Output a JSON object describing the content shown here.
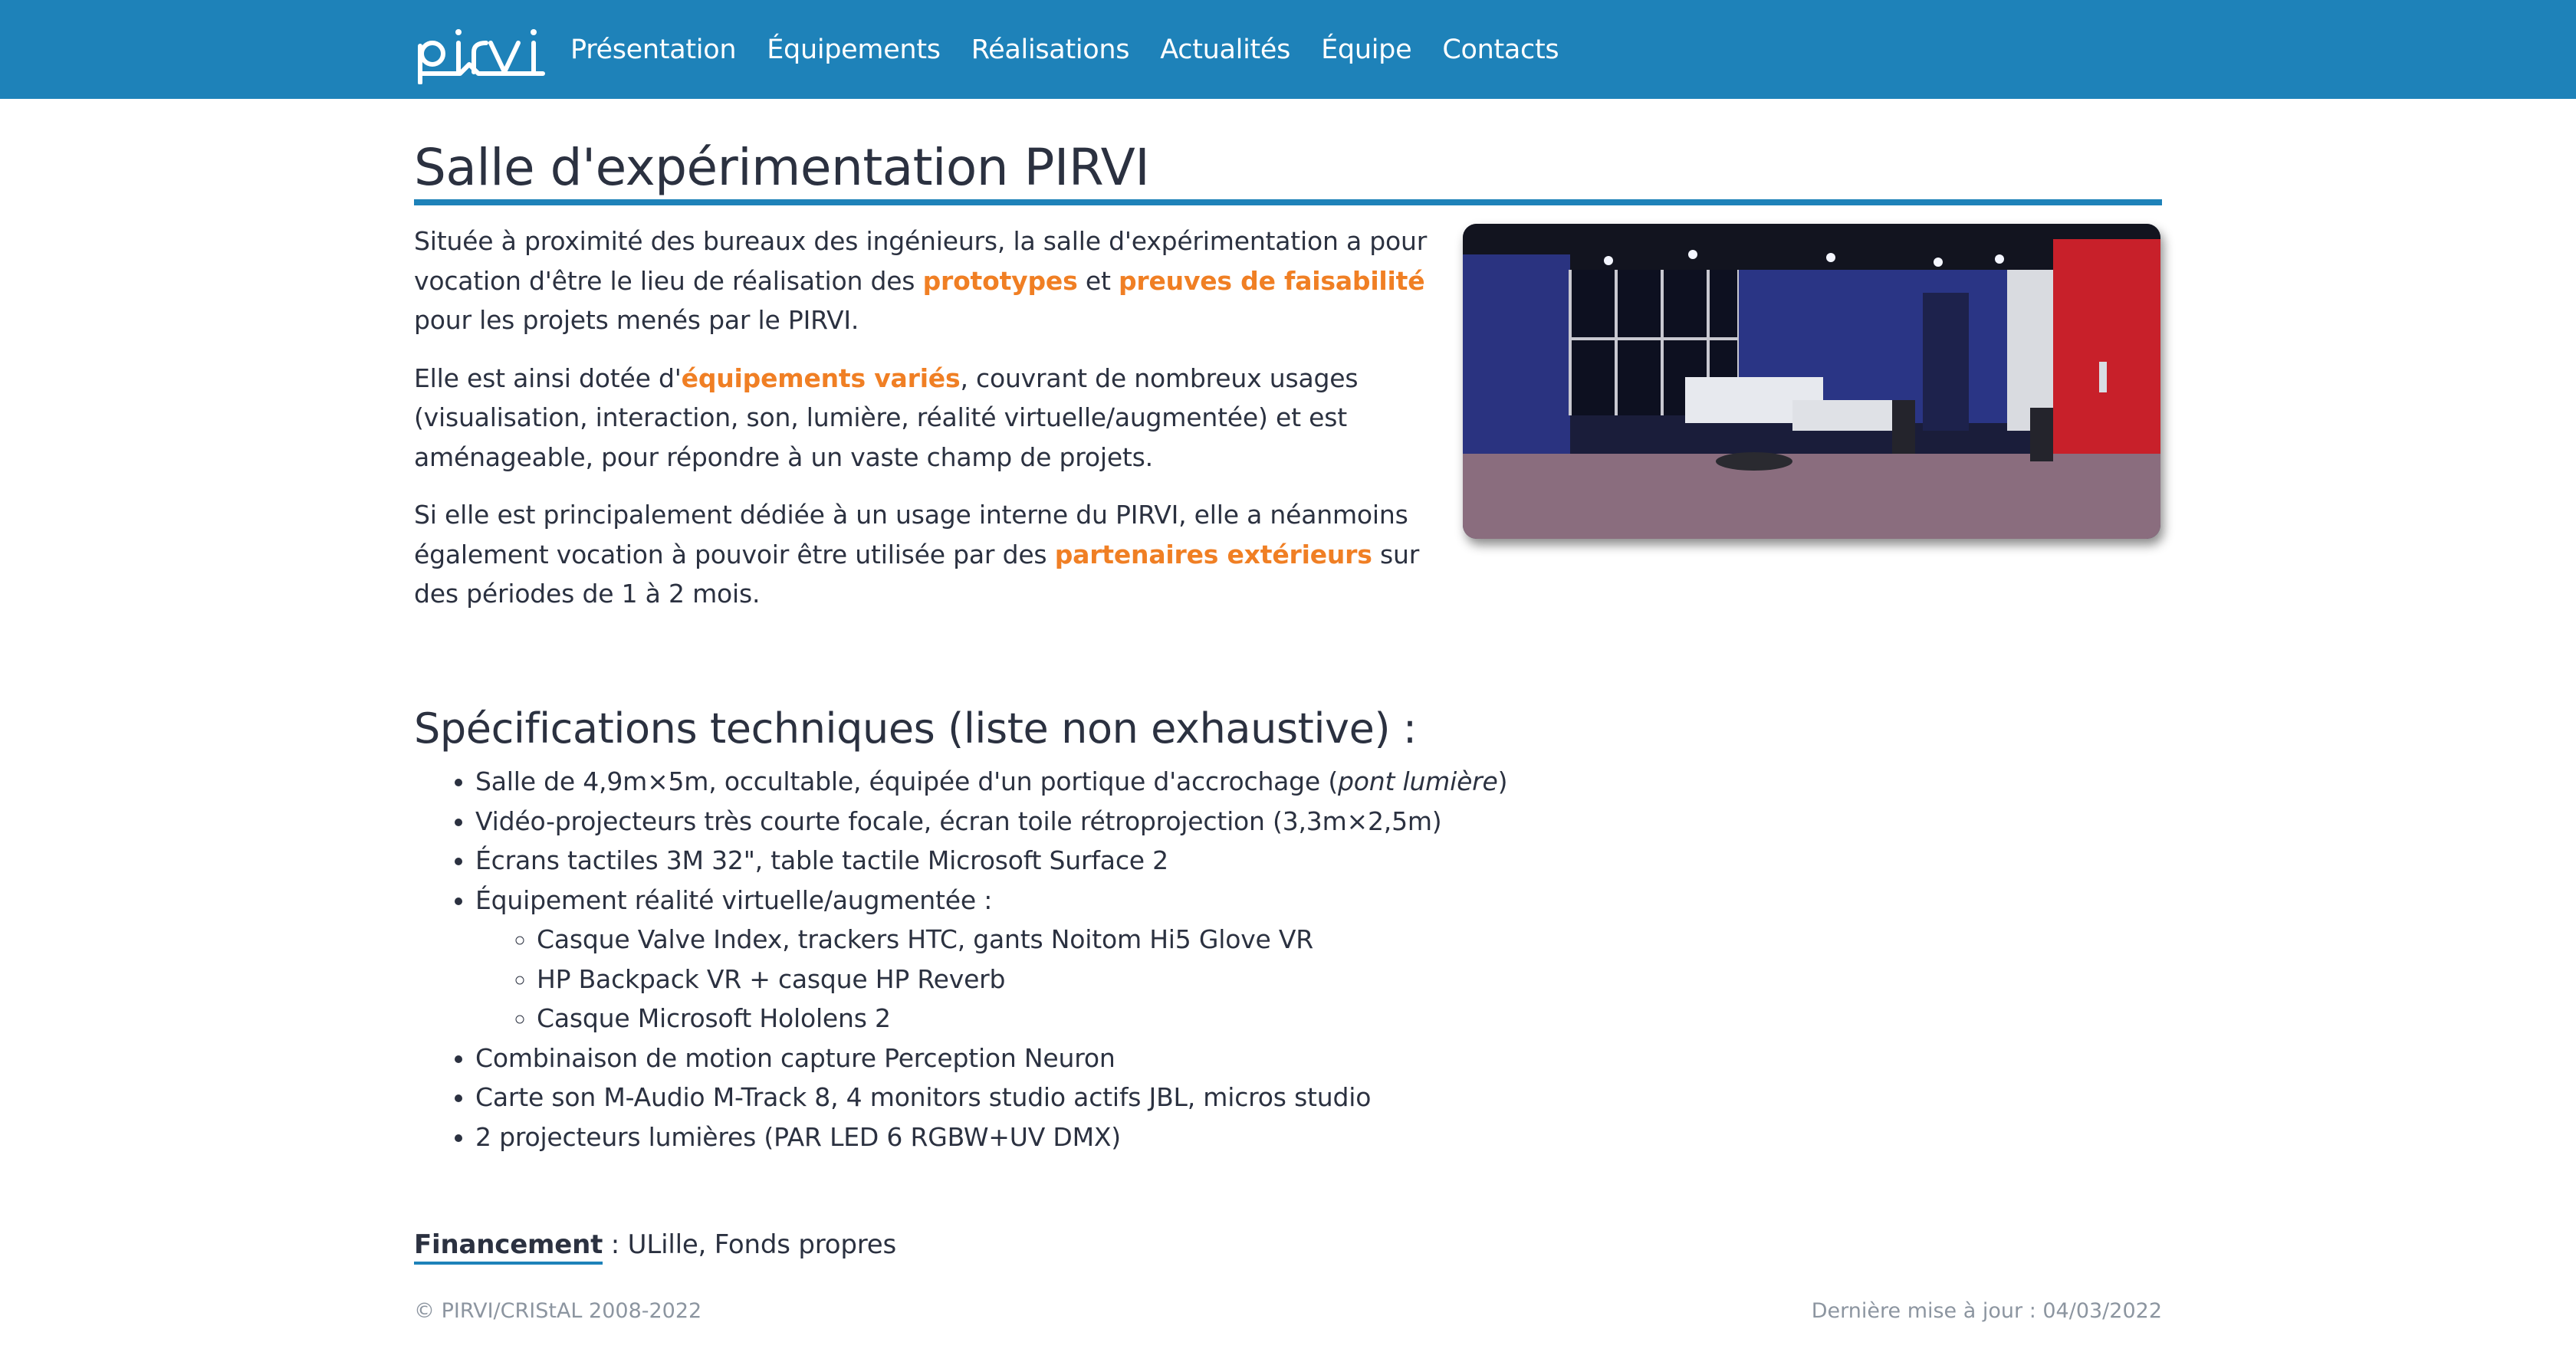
{
  "nav": {
    "logo_text": "pirvi",
    "items": [
      "Présentation",
      "Équipements",
      "Réalisations",
      "Actualités",
      "Équipe",
      "Contacts"
    ]
  },
  "page": {
    "title": "Salle d'expérimentation PIRVI",
    "intro": [
      {
        "t1": "Située à proximité des bureaux des ingénieurs, la salle d'expérimentation a pour vocation d'être le lieu de réalisation des ",
        "h1": "prototypes",
        "t2": " et ",
        "h2": "preuves de faisabilité",
        "t3": " pour les projets menés par le PIRVI."
      },
      {
        "t1": "Elle est ainsi dotée d'",
        "h1": "équipements variés",
        "t2": ", couvrant de nombreux usages (visualisation, interaction, son, lumière, réalité virtuelle/augmentée) et est aménageable, pour répondre à un vaste champ de projets."
      },
      {
        "t1": "Si elle est principalement dédiée à un usage interne du PIRVI, elle a néanmoins également vocation à pouvoir être utilisée par des ",
        "h1": "partenaires extérieurs",
        "t2": " sur des périodes de 1 à 2 mois."
      }
    ],
    "photo_icon": "room-panorama-photo"
  },
  "specs": {
    "title": "Spécifications techniques (liste non exhaustive) :",
    "item1_prefix": "Salle de 4,9m×5m, occultable, équipée d'un portique d'accrochage (",
    "item1_italic": "pont lumière",
    "item1_suffix": ")",
    "item2": "Vidéo-projecteurs très courte focale, écran toile rétroprojection (3,3m×2,5m)",
    "item3": "Écrans tactiles 3M 32\", table tactile Microsoft Surface 2",
    "item4": "Équipement réalité virtuelle/augmentée :",
    "sub": [
      "Casque Valve Index, trackers HTC, gants Noitom Hi5 Glove VR",
      "HP Backpack VR + casque HP Reverb",
      "Casque Microsoft Hololens 2"
    ],
    "item5": "Combinaison de motion capture Perception Neuron",
    "item6": "Carte son M-Audio M-Track 8, 4 monitors studio actifs JBL, micros studio",
    "item7": "2 projecteurs lumières (PAR LED 6 RGBW+UV DMX)"
  },
  "funding": {
    "label": "Financement",
    "value": " : ULille, Fonds propres"
  },
  "footer": {
    "copyright": "© PIRVI/CRIStAL 2008-2022",
    "updated": "Dernière mise à jour : 04/03/2022"
  },
  "colors": {
    "nav_bg": "#1e82b9",
    "accent": "#f07f24",
    "text": "#2b3140",
    "muted": "#8c95a0"
  }
}
